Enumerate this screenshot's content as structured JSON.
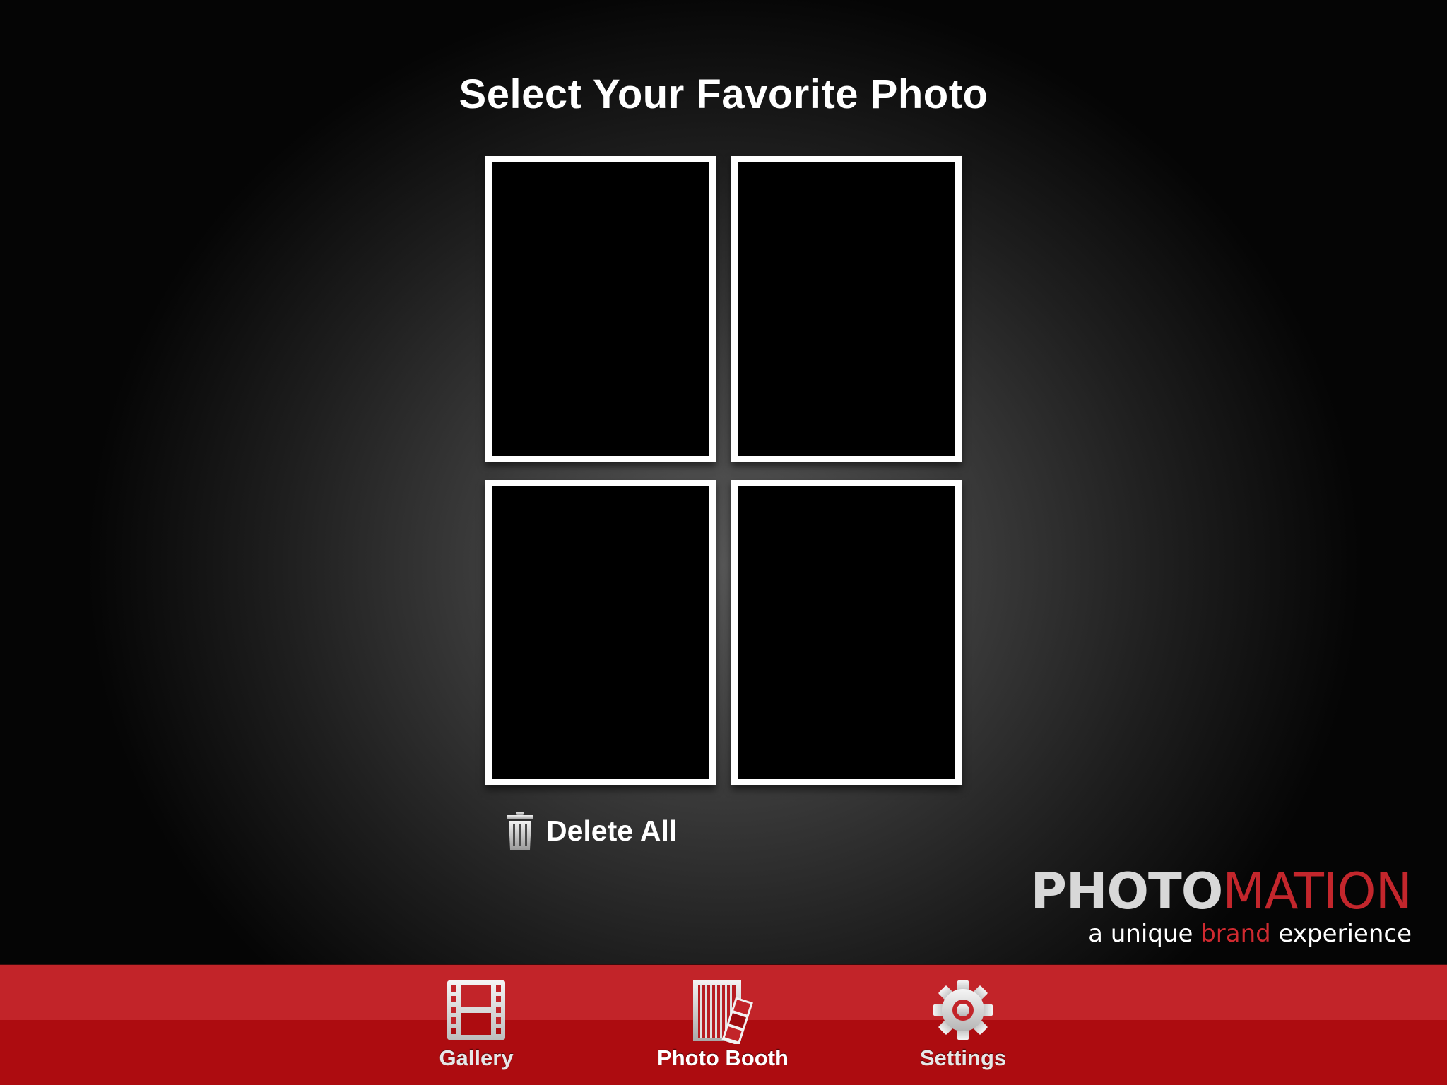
{
  "page": {
    "title": "Select Your Favorite Photo"
  },
  "photos": {
    "count": 4
  },
  "actions": {
    "delete_all_label": "Delete All",
    "delete_icon": "trash-icon"
  },
  "brand": {
    "logo_primary": "PHOTO",
    "logo_secondary": "MATION",
    "tagline_pre": "a unique ",
    "tagline_accent": "brand",
    "tagline_post": " experience",
    "colors": {
      "logo_primary": "#d8d8d8",
      "accent": "#c3262c"
    }
  },
  "tabbar": {
    "colors": {
      "top": "#c22429",
      "bottom": "#ad0c10"
    },
    "tabs": [
      {
        "label": "Gallery",
        "icon": "film-strip-icon",
        "active": false
      },
      {
        "label": "Photo Booth",
        "icon": "photo-booth-icon",
        "active": true
      },
      {
        "label": "Settings",
        "icon": "gear-icon",
        "active": false
      }
    ]
  }
}
